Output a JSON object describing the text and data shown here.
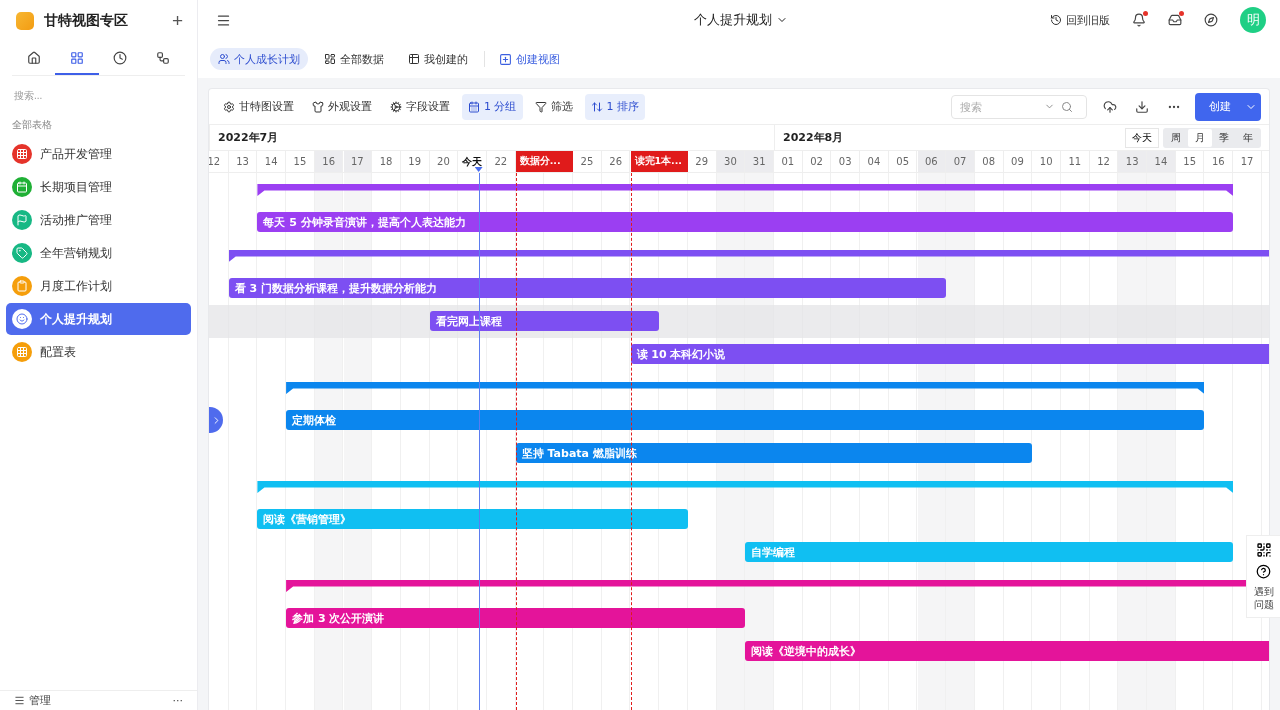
{
  "sidebar": {
    "title": "甘特视图专区",
    "add": "+",
    "tabs": [
      {
        "kind": "home",
        "selected": false
      },
      {
        "kind": "grid",
        "selected": true
      },
      {
        "kind": "clock",
        "selected": false
      },
      {
        "kind": "flow",
        "selected": false
      }
    ],
    "search": {
      "placeholder": "搜索..."
    },
    "section": "全部表格",
    "items": [
      {
        "label": "产品开发管理",
        "color": "#e5332a",
        "selected": false
      },
      {
        "label": "长期项目管理",
        "color": "#1fb035",
        "selected": false
      },
      {
        "label": "活动推广管理",
        "color": "#17b884",
        "selected": false
      },
      {
        "label": "全年营销规划",
        "color": "#17b884",
        "selected": false
      },
      {
        "label": "月度工作计划",
        "color": "#f59e0b",
        "selected": false
      },
      {
        "label": "个人提升规划",
        "color": "#ffffff",
        "selected": true
      },
      {
        "label": "配置表",
        "color": "#f59e0b",
        "selected": false
      }
    ],
    "footer": {
      "label": "管理",
      "more": "···"
    }
  },
  "topbar": {
    "title": "个人提升规划",
    "old_version": "回到旧版",
    "avatar": "明"
  },
  "views": [
    {
      "label": "个人成长计划",
      "selected": true
    },
    {
      "label": "全部数据",
      "selected": false
    },
    {
      "label": "我创建的",
      "selected": false
    }
  ],
  "create_view": "创建视图",
  "toolbar": [
    {
      "kind": "gantt",
      "label": "甘特图设置",
      "selected": false
    },
    {
      "kind": "look",
      "label": "外观设置",
      "selected": false
    },
    {
      "kind": "field",
      "label": "字段设置",
      "selected": false
    },
    {
      "kind": "group",
      "label": "1 分组",
      "selected": true
    },
    {
      "kind": "filter",
      "label": "筛选",
      "selected": false
    },
    {
      "kind": "sort",
      "label": "1 排序",
      "selected": true
    }
  ],
  "search": {
    "placeholder": "搜索"
  },
  "create": "创建",
  "months": [
    "2022年7月",
    "2022年8月"
  ],
  "today_button": "今天",
  "scales": [
    {
      "label": "周",
      "selected": false
    },
    {
      "label": "月",
      "selected": true
    },
    {
      "label": "季",
      "selected": false
    },
    {
      "label": "年",
      "selected": false
    }
  ],
  "days": [
    {
      "kind": "day",
      "label": "12",
      "weekend": false
    },
    {
      "kind": "day",
      "label": "13",
      "weekend": false
    },
    {
      "kind": "day",
      "label": "14",
      "weekend": false
    },
    {
      "kind": "day",
      "label": "15",
      "weekend": false
    },
    {
      "kind": "day",
      "label": "16",
      "weekend": true
    },
    {
      "kind": "day",
      "label": "17",
      "weekend": true
    },
    {
      "kind": "day",
      "label": "18",
      "weekend": false
    },
    {
      "kind": "day",
      "label": "19",
      "weekend": false
    },
    {
      "kind": "day",
      "label": "20",
      "weekend": false
    },
    {
      "kind": "today",
      "label": "今天",
      "weekend": false
    },
    {
      "kind": "day",
      "label": "22",
      "weekend": false
    },
    {
      "kind": "milestone",
      "label": "数据分..."
    },
    {
      "kind": "day",
      "label": "25",
      "weekend": false
    },
    {
      "kind": "day",
      "label": "26",
      "weekend": false
    },
    {
      "kind": "milestone",
      "label": "读完1本..."
    },
    {
      "kind": "day",
      "label": "29",
      "weekend": false
    },
    {
      "kind": "day",
      "label": "30",
      "weekend": true
    },
    {
      "kind": "day",
      "label": "31",
      "weekend": true
    },
    {
      "kind": "day",
      "label": "01",
      "weekend": false
    },
    {
      "kind": "day",
      "label": "02",
      "weekend": false
    },
    {
      "kind": "day",
      "label": "03",
      "weekend": false
    },
    {
      "kind": "day",
      "label": "04",
      "weekend": false
    },
    {
      "kind": "day",
      "label": "05",
      "weekend": false
    },
    {
      "kind": "day",
      "label": "06",
      "weekend": true
    },
    {
      "kind": "day",
      "label": "07",
      "weekend": true
    },
    {
      "kind": "day",
      "label": "08",
      "weekend": false
    },
    {
      "kind": "day",
      "label": "09",
      "weekend": false
    },
    {
      "kind": "day",
      "label": "10",
      "weekend": false
    },
    {
      "kind": "day",
      "label": "11",
      "weekend": false
    },
    {
      "kind": "day",
      "label": "12",
      "weekend": false
    },
    {
      "kind": "day",
      "label": "13",
      "weekend": true
    },
    {
      "kind": "day",
      "label": "14",
      "weekend": true
    },
    {
      "kind": "day",
      "label": "15",
      "weekend": false
    },
    {
      "kind": "day",
      "label": "16",
      "weekend": false
    },
    {
      "kind": "day",
      "label": "17",
      "weekend": false
    }
  ],
  "groups": [
    {
      "color": "#9b3ff2",
      "tasks": [
        {
          "label": "每天 5 分钟录音演讲，提高个人表达能力",
          "selected": false
        }
      ]
    },
    {
      "color": "#7d4ff2",
      "tasks": [
        {
          "label": "看 3 门数据分析课程，提升数据分析能力",
          "selected": false
        },
        {
          "label": "看完网上课程",
          "selected": true
        },
        {
          "label": "读 10 本科幻小说",
          "selected": false
        }
      ]
    },
    {
      "color": "#0b86ee",
      "tasks": [
        {
          "label": "定期体检",
          "selected": false
        },
        {
          "label": "坚持 Tabata 燃脂训练",
          "selected": false
        }
      ]
    },
    {
      "color": "#10bff2",
      "tasks": [
        {
          "label": "阅读《营销管理》",
          "selected": false
        },
        {
          "label": "自学编程",
          "selected": false
        }
      ]
    },
    {
      "color": "#e4149a",
      "tasks": [
        {
          "label": "参加 3 次公开演讲",
          "selected": false
        },
        {
          "label": "阅读《逆境中的成长》",
          "selected": false
        }
      ]
    }
  ],
  "help": "遇到问题"
}
